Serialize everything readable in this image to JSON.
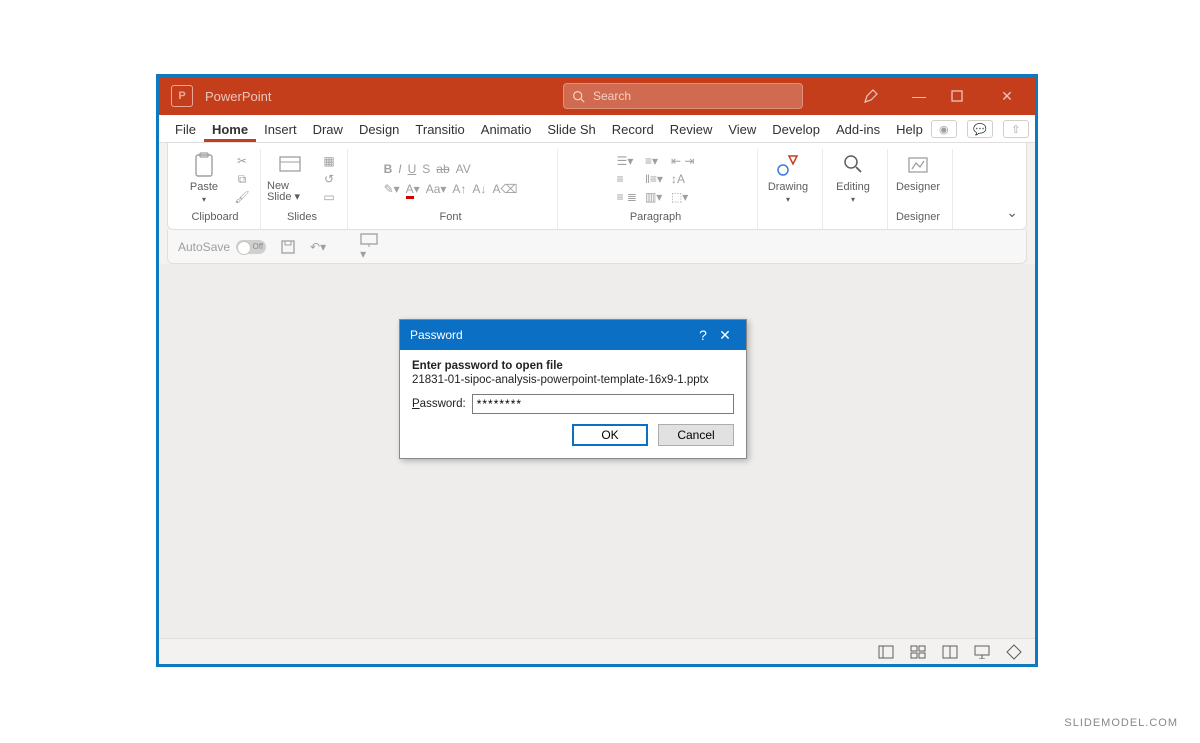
{
  "titlebar": {
    "app_name": "PowerPoint",
    "search_placeholder": "Search"
  },
  "menubar": {
    "tabs": [
      "File",
      "Home",
      "Insert",
      "Draw",
      "Design",
      "Transitio",
      "Animatio",
      "Slide Sh",
      "Record",
      "Review",
      "View",
      "Develop",
      "Add-ins",
      "Help"
    ],
    "active_index": 1
  },
  "ribbon": {
    "clipboard": {
      "label": "Clipboard",
      "paste_label": "Paste"
    },
    "slides": {
      "label": "Slides",
      "newslide_label": "New Slide"
    },
    "font": {
      "label": "Font"
    },
    "paragraph": {
      "label": "Paragraph"
    },
    "drawing": {
      "label": "Drawing"
    },
    "editing": {
      "label": "Editing"
    },
    "designer": {
      "label": "Designer",
      "btn_label": "Designer"
    }
  },
  "qat": {
    "autosave_label": "AutoSave",
    "autosave_state": "Off"
  },
  "dialog": {
    "title": "Password",
    "prompt": "Enter password to open file",
    "filename": "21831-01-sipoc-analysis-powerpoint-template-16x9-1.pptx",
    "field_label_pre": "P",
    "field_label_post": "assword:",
    "value": "********",
    "ok": "OK",
    "cancel": "Cancel"
  },
  "watermark": "SLIDEMODEL.COM"
}
